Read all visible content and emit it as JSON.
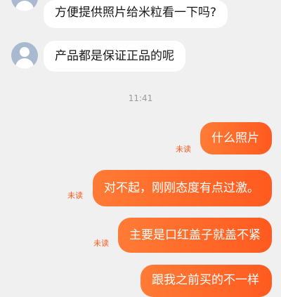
{
  "messages": [
    {
      "side": "left",
      "text": "方便提供照片给米粒看一下吗?"
    },
    {
      "side": "left",
      "text": "产品都是保证正品的呢"
    },
    {
      "type": "time",
      "text": "11:41"
    },
    {
      "side": "right",
      "text": "什么照片",
      "status": "未读"
    },
    {
      "side": "right",
      "text": "对不起，刚刚态度有点过激。",
      "status": "未读"
    },
    {
      "side": "right",
      "text": "主要是口红盖子就盖不紧",
      "status": "未读"
    },
    {
      "side": "right",
      "text": "跟我之前买的不一样"
    }
  ],
  "colors": {
    "background": "#f0f0f0",
    "right_bubble": "#ff6a2a",
    "unread": "#ff5a1f",
    "time": "#9a9a9a"
  }
}
